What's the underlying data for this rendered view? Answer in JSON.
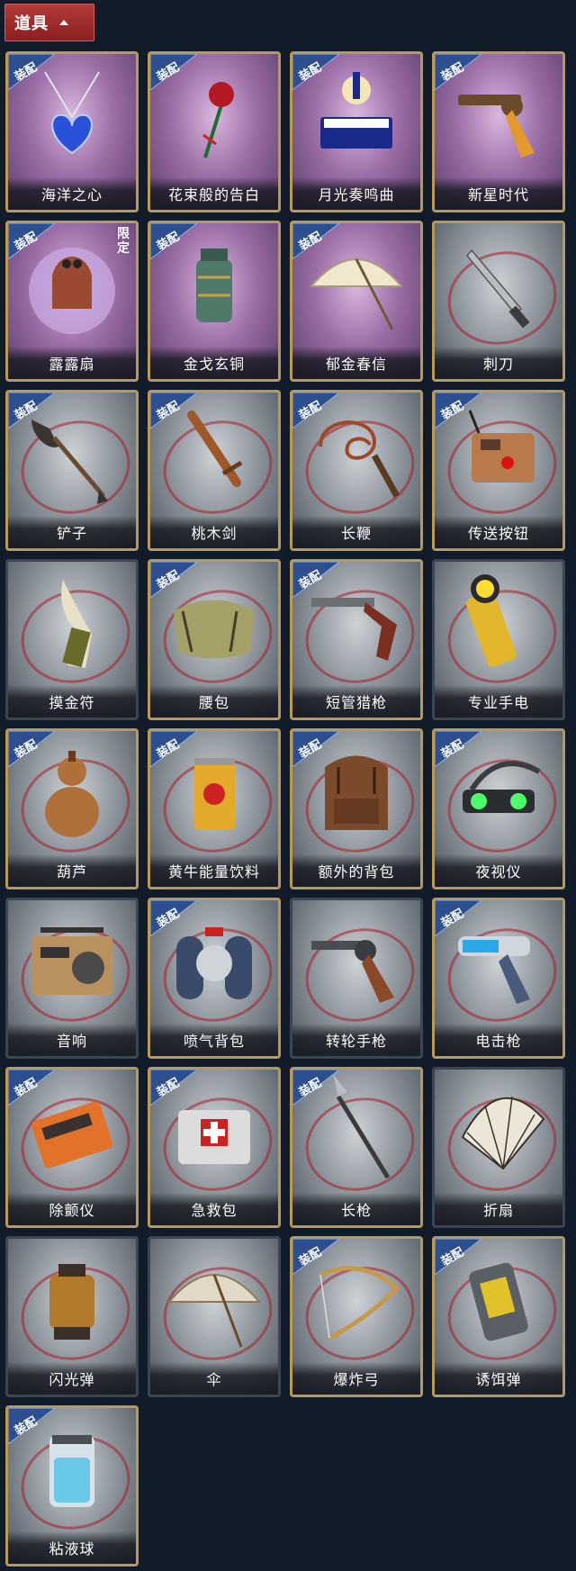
{
  "header": {
    "title": "道具"
  },
  "badge_text": "装配",
  "limited_text": "限定",
  "items": [
    {
      "name": "海洋之心",
      "equipped": true,
      "bg": "purple",
      "frame": "gold",
      "icon": "heart-necklace-icon",
      "limited": false
    },
    {
      "name": "花束般的告白",
      "equipped": true,
      "bg": "purple",
      "frame": "gold",
      "icon": "rose-icon",
      "limited": false
    },
    {
      "name": "月光奏鸣曲",
      "equipped": true,
      "bg": "purple",
      "frame": "gold",
      "icon": "piano-icon",
      "limited": false
    },
    {
      "name": "新星时代",
      "equipped": true,
      "bg": "purple",
      "frame": "gold",
      "icon": "revolver-gold-icon",
      "limited": false
    },
    {
      "name": "露露扇",
      "equipped": true,
      "bg": "purple",
      "frame": "gold",
      "icon": "character-fan-icon",
      "limited": true
    },
    {
      "name": "金戈玄铜",
      "equipped": true,
      "bg": "purple",
      "frame": "gold",
      "icon": "bronze-grenade-icon",
      "limited": false
    },
    {
      "name": "郁金春信",
      "equipped": true,
      "bg": "purple",
      "frame": "gold",
      "icon": "parasol-icon",
      "limited": false
    },
    {
      "name": "刺刀",
      "equipped": false,
      "bg": "grey",
      "frame": "gold",
      "icon": "bayonet-icon",
      "limited": false
    },
    {
      "name": "铲子",
      "equipped": true,
      "bg": "grey",
      "frame": "gold",
      "icon": "shovel-icon",
      "limited": false
    },
    {
      "name": "桃木剑",
      "equipped": true,
      "bg": "grey",
      "frame": "gold",
      "icon": "wooden-sword-icon",
      "limited": false
    },
    {
      "name": "长鞭",
      "equipped": true,
      "bg": "grey",
      "frame": "gold",
      "icon": "whip-icon",
      "limited": false
    },
    {
      "name": "传送按钮",
      "equipped": true,
      "bg": "grey",
      "frame": "gold",
      "icon": "teleport-button-icon",
      "limited": false
    },
    {
      "name": "摸金符",
      "equipped": false,
      "bg": "grey",
      "frame": "plain",
      "icon": "amulet-icon",
      "limited": false
    },
    {
      "name": "腰包",
      "equipped": true,
      "bg": "grey",
      "frame": "gold",
      "icon": "waist-bag-icon",
      "limited": false
    },
    {
      "name": "短管猎枪",
      "equipped": true,
      "bg": "grey",
      "frame": "gold",
      "icon": "shotgun-icon",
      "limited": false
    },
    {
      "name": "专业手电",
      "equipped": false,
      "bg": "grey",
      "frame": "plain",
      "icon": "flashlight-icon",
      "limited": false
    },
    {
      "name": "葫芦",
      "equipped": true,
      "bg": "grey",
      "frame": "gold",
      "icon": "gourd-icon",
      "limited": false
    },
    {
      "name": "黄牛能量饮料",
      "equipped": true,
      "bg": "grey",
      "frame": "gold",
      "icon": "energy-drink-icon",
      "limited": false
    },
    {
      "name": "额外的背包",
      "equipped": true,
      "bg": "grey",
      "frame": "gold",
      "icon": "backpack-icon",
      "limited": false
    },
    {
      "name": "夜视仪",
      "equipped": true,
      "bg": "grey",
      "frame": "gold",
      "icon": "night-vision-icon",
      "limited": false
    },
    {
      "name": "音响",
      "equipped": false,
      "bg": "grey",
      "frame": "plain",
      "icon": "radio-icon",
      "limited": false
    },
    {
      "name": "喷气背包",
      "equipped": true,
      "bg": "grey",
      "frame": "gold",
      "icon": "jetpack-icon",
      "limited": false
    },
    {
      "name": "转轮手枪",
      "equipped": false,
      "bg": "grey",
      "frame": "plain",
      "icon": "revolver-icon",
      "limited": false
    },
    {
      "name": "电击枪",
      "equipped": true,
      "bg": "grey",
      "frame": "gold",
      "icon": "shock-gun-icon",
      "limited": false
    },
    {
      "name": "除颤仪",
      "equipped": true,
      "bg": "grey",
      "frame": "gold",
      "icon": "defibrillator-icon",
      "limited": false
    },
    {
      "name": "急救包",
      "equipped": true,
      "bg": "grey",
      "frame": "gold",
      "icon": "first-aid-kit-icon",
      "limited": false
    },
    {
      "name": "长枪",
      "equipped": true,
      "bg": "grey",
      "frame": "gold",
      "icon": "spear-icon",
      "limited": false
    },
    {
      "name": "折扇",
      "equipped": false,
      "bg": "grey",
      "frame": "plain",
      "icon": "folding-fan-icon",
      "limited": false
    },
    {
      "name": "闪光弹",
      "equipped": false,
      "bg": "grey",
      "frame": "plain",
      "icon": "flash-grenade-icon",
      "limited": false
    },
    {
      "name": "伞",
      "equipped": false,
      "bg": "grey",
      "frame": "plain",
      "icon": "umbrella-icon",
      "limited": false
    },
    {
      "name": "爆炸弓",
      "equipped": true,
      "bg": "grey",
      "frame": "gold",
      "icon": "bow-icon",
      "limited": false
    },
    {
      "name": "诱饵弹",
      "equipped": true,
      "bg": "grey",
      "frame": "gold",
      "icon": "decoy-grenade-icon",
      "limited": false
    },
    {
      "name": "粘液球",
      "equipped": true,
      "bg": "grey",
      "frame": "gold",
      "icon": "slime-canister-icon",
      "limited": false
    }
  ],
  "colors": {
    "badge_blue": "#2e4f8f",
    "gold_frame": "#b99a55",
    "background": "#121b2a",
    "header_red": "#a02c2c"
  }
}
